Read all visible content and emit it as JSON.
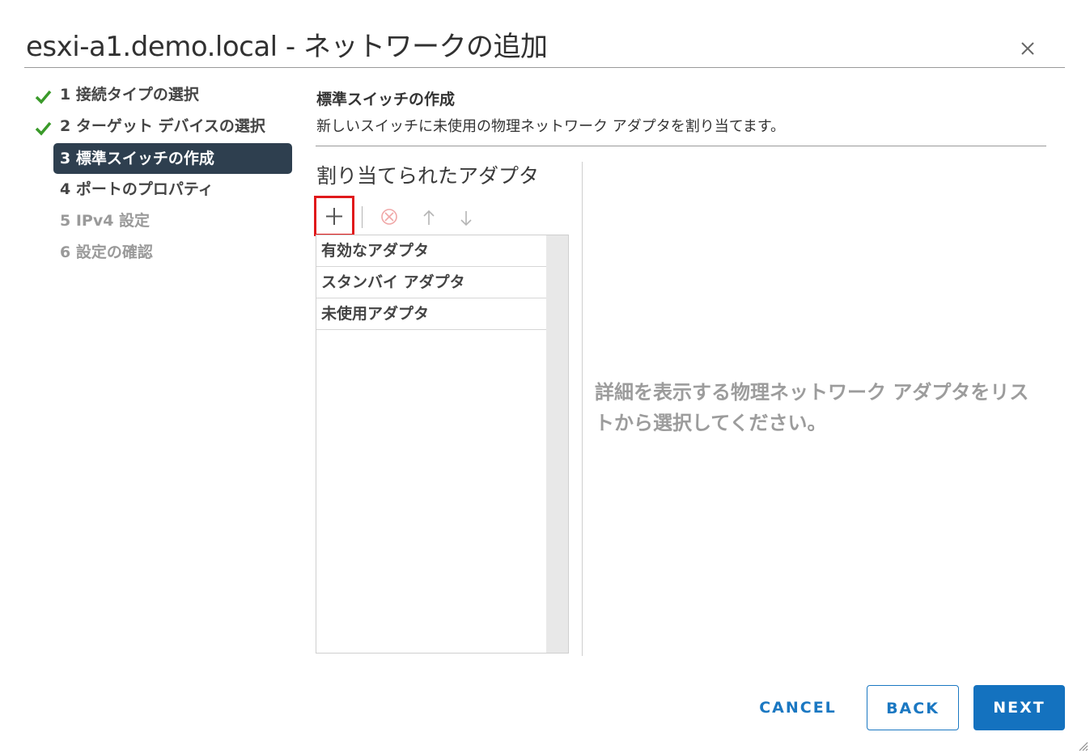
{
  "dialog": {
    "title": "esxi-a1.demo.local - ネットワークの追加",
    "close_icon": "close-icon"
  },
  "steps": [
    {
      "label": "1 接続タイプの選択",
      "state": "completed"
    },
    {
      "label": "2 ターゲット デバイスの選択",
      "state": "completed"
    },
    {
      "label": "3 標準スイッチの作成",
      "state": "active"
    },
    {
      "label": "4 ポートのプロパティ",
      "state": "pending"
    },
    {
      "label": "5 IPv4 設定",
      "state": "disabled"
    },
    {
      "label": "6 設定の確認",
      "state": "disabled"
    }
  ],
  "section": {
    "title": "標準スイッチの作成",
    "description": "新しいスイッチに未使用の物理ネットワーク アダプタを割り当てます。"
  },
  "adapters": {
    "heading": "割り当てられたアダプタ",
    "toolbar": {
      "add_icon": "plus-icon",
      "remove_icon": "remove-icon",
      "move_up_icon": "arrow-up-icon",
      "move_down_icon": "arrow-down-icon",
      "highlight_color": "#e0191b"
    },
    "groups": [
      "有効なアダプタ",
      "スタンバイ アダプタ",
      "未使用アダプタ"
    ]
  },
  "details": {
    "placeholder": "詳細を表示する物理ネットワーク アダプタをリストから選択してください。"
  },
  "footer": {
    "cancel_label": "CANCEL",
    "back_label": "BACK",
    "next_label": "NEXT"
  },
  "colors": {
    "accent": "#1472bf",
    "active_step_bg": "#2e3f4f",
    "check_green": "#3a9a2a"
  }
}
